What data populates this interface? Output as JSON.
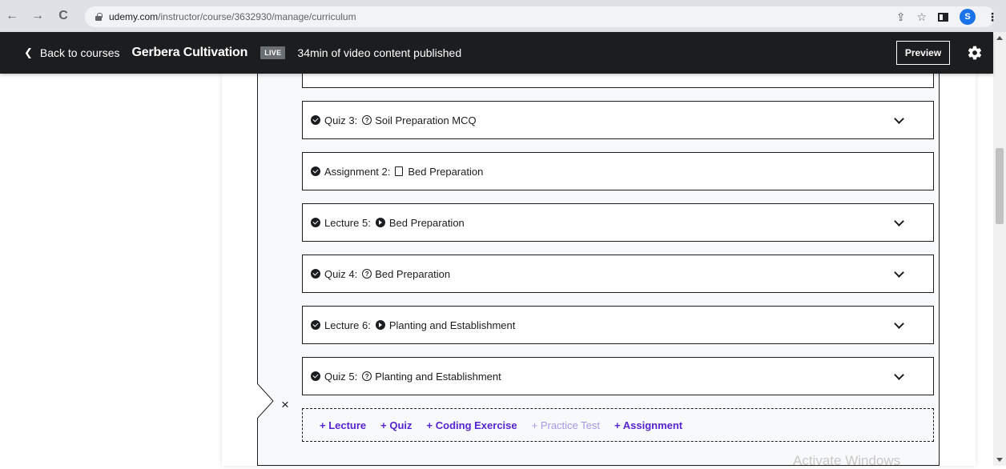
{
  "browser": {
    "url_domain": "udemy.com",
    "url_path": "/instructor/course/3632930/manage/curriculum",
    "profile_initial": "S"
  },
  "header": {
    "back_label": "Back to courses",
    "course_title": "Gerbera Cultivation",
    "status_badge": "LIVE",
    "published_text": "34min of video content published",
    "preview_label": "Preview"
  },
  "curriculum": {
    "items": [
      {
        "prefix": "Quiz 3:",
        "kind": "quiz",
        "title": "Soil Preparation MCQ",
        "expandable": true
      },
      {
        "prefix": "Assignment 2:",
        "kind": "assignment",
        "title": "Bed Preparation",
        "expandable": false
      },
      {
        "prefix": "Lecture 5:",
        "kind": "lecture",
        "title": "Bed Preparation",
        "expandable": true
      },
      {
        "prefix": "Quiz 4:",
        "kind": "quiz",
        "title": "Bed Preparation",
        "expandable": true
      },
      {
        "prefix": "Lecture 6:",
        "kind": "lecture",
        "title": "Planting and Establishment",
        "expandable": true
      },
      {
        "prefix": "Quiz 5:",
        "kind": "quiz",
        "title": "Planting and Establishment",
        "expandable": true
      }
    ],
    "add_actions": {
      "lecture": "+ Lecture",
      "quiz": "+ Quiz",
      "coding": "+ Coding Exercise",
      "practice": "+ Practice Test",
      "assignment": "+ Assignment"
    },
    "close_symbol": "×"
  },
  "watermark": "Activate Windows",
  "colors": {
    "header_bg": "#1c1d1f",
    "accent_purple": "#5624d0",
    "disabled_purple": "#a898e8",
    "section_bg": "#f7f9fa"
  }
}
